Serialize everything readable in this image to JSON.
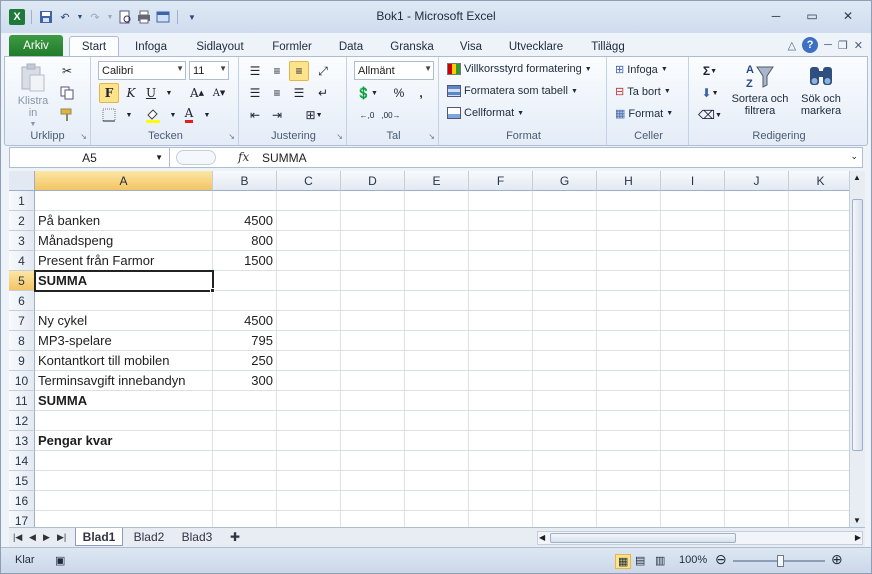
{
  "window": {
    "title": "Bok1  -  Microsoft Excel"
  },
  "tabs": [
    "Arkiv",
    "Start",
    "Infoga",
    "Sidlayout",
    "Formler",
    "Data",
    "Granska",
    "Visa",
    "Utvecklare",
    "Tillägg"
  ],
  "ribbon": {
    "clipboard": {
      "paste": "Klistra in",
      "label": "Urklipp"
    },
    "font": {
      "name": "Calibri",
      "size": "11",
      "label": "Tecken"
    },
    "alignment": {
      "label": "Justering"
    },
    "number": {
      "format": "Allmänt",
      "label": "Tal"
    },
    "styles": {
      "conditional": "Villkorsstyrd formatering",
      "table": "Formatera som tabell",
      "cell": "Cellformat",
      "label": "Format"
    },
    "cells": {
      "insert": "Infoga",
      "delete": "Ta bort",
      "format": "Format",
      "label": "Celler"
    },
    "editing": {
      "sort": "Sortera och filtrera",
      "find": "Sök och markera",
      "label": "Redigering"
    }
  },
  "formula_bar": {
    "namebox": "A5",
    "fx": "fx",
    "content": "SUMMA"
  },
  "columns": [
    "A",
    "B",
    "C",
    "D",
    "E",
    "F",
    "G",
    "H",
    "I",
    "J",
    "K"
  ],
  "rows": [
    {
      "n": "1",
      "a": "",
      "b": ""
    },
    {
      "n": "2",
      "a": "På banken",
      "b": "4500"
    },
    {
      "n": "3",
      "a": "Månadspeng",
      "b": "800"
    },
    {
      "n": "4",
      "a": "Present från Farmor",
      "b": "1500"
    },
    {
      "n": "5",
      "a": "SUMMA",
      "b": "",
      "bold": true
    },
    {
      "n": "6",
      "a": "",
      "b": ""
    },
    {
      "n": "7",
      "a": "Ny cykel",
      "b": "4500"
    },
    {
      "n": "8",
      "a": "MP3-spelare",
      "b": "795"
    },
    {
      "n": "9",
      "a": "Kontantkort till mobilen",
      "b": "250"
    },
    {
      "n": "10",
      "a": "Terminsavgift innebandyn",
      "b": "300"
    },
    {
      "n": "11",
      "a": "SUMMA",
      "b": "",
      "bold": true
    },
    {
      "n": "12",
      "a": "",
      "b": ""
    },
    {
      "n": "13",
      "a": "Pengar kvar",
      "b": "",
      "bold": true
    },
    {
      "n": "14",
      "a": "",
      "b": ""
    },
    {
      "n": "15",
      "a": "",
      "b": ""
    },
    {
      "n": "16",
      "a": "",
      "b": ""
    },
    {
      "n": "17",
      "a": "",
      "b": ""
    }
  ],
  "selected_cell": "A5",
  "sheets": [
    "Blad1",
    "Blad2",
    "Blad3"
  ],
  "status": {
    "ready": "Klar",
    "zoom": "100%"
  },
  "colors": {
    "file_tab": "#1f7a2a",
    "selection_header": "#f3c462"
  }
}
